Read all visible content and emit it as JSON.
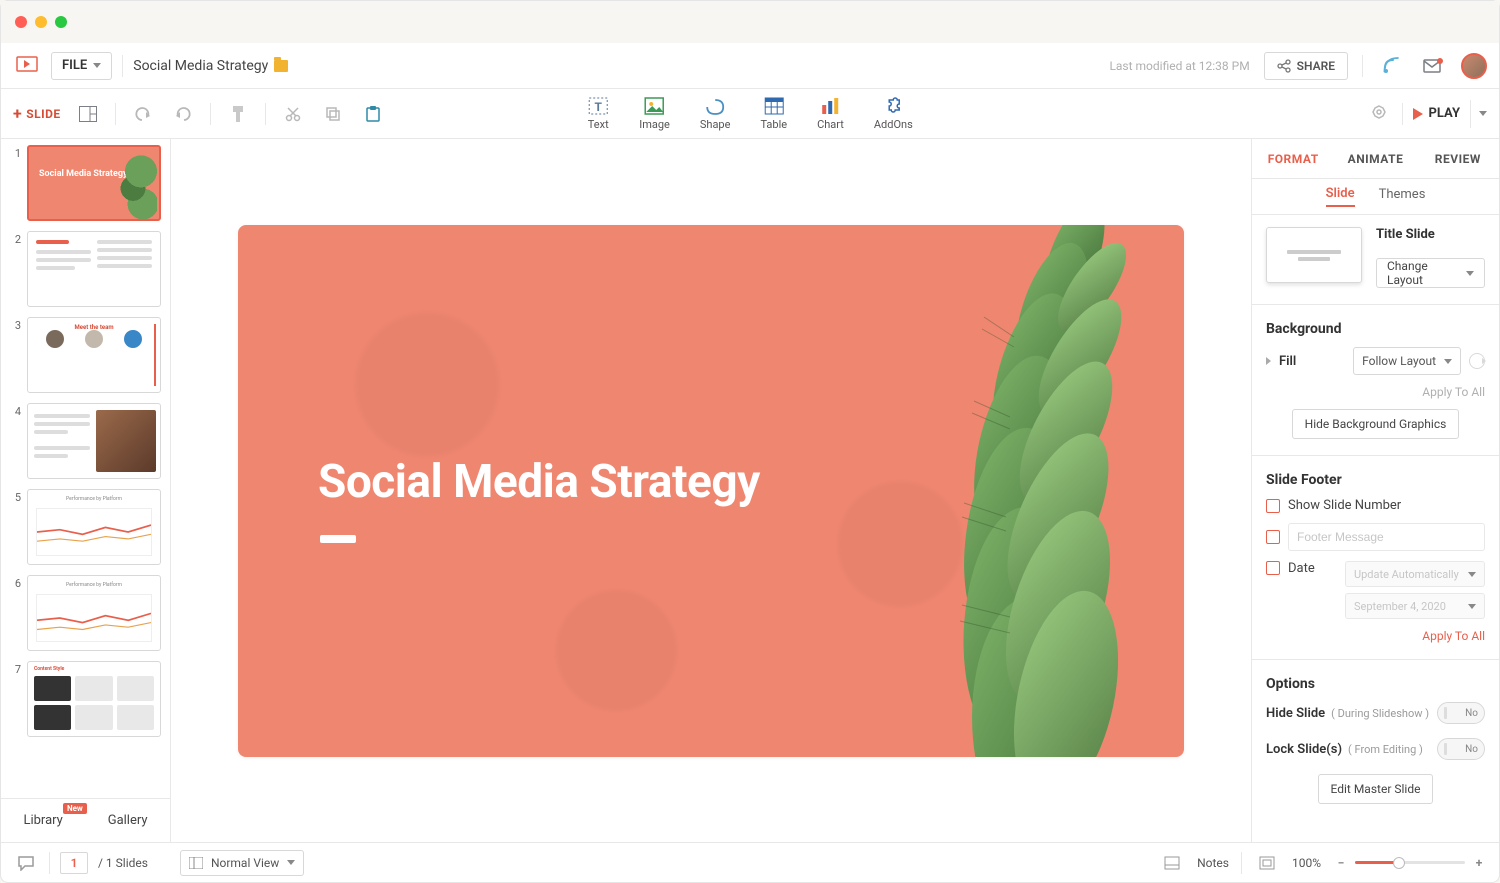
{
  "header": {
    "file_label": "FILE",
    "doc_title": "Social Media Strategy",
    "last_modified": "Last modified at 12:38 PM",
    "share_label": "SHARE"
  },
  "toolbar2": {
    "add_slide": "SLIDE",
    "insert": {
      "text": "Text",
      "image": "Image",
      "shape": "Shape",
      "table": "Table",
      "chart": "Chart",
      "addons": "AddOns"
    },
    "play_label": "PLAY"
  },
  "thumbs": {
    "title_slide_text": "Social Media Strategy",
    "rail_tabs": {
      "library": "Library",
      "library_badge": "New",
      "gallery": "Gallery"
    }
  },
  "canvas": {
    "slide_title": "Social Media Strategy"
  },
  "panel": {
    "tabs": {
      "format": "FORMAT",
      "animate": "ANIMATE",
      "review": "REVIEW"
    },
    "subtabs": {
      "slide": "Slide",
      "themes": "Themes"
    },
    "layout_name": "Title Slide",
    "change_layout": "Change Layout",
    "background": {
      "title": "Background",
      "fill_label": "Fill",
      "fill_value": "Follow Layout",
      "apply_all": "Apply To All",
      "hide_bg": "Hide Background Graphics"
    },
    "footer": {
      "title": "Slide Footer",
      "show_num": "Show Slide Number",
      "msg_placeholder": "Footer Message",
      "date_label": "Date",
      "update_auto": "Update Automatically",
      "date_value": "September 4, 2020",
      "apply_all": "Apply To All"
    },
    "options": {
      "title": "Options",
      "hide_slide": "Hide Slide",
      "hide_hint": "( During Slideshow )",
      "lock_slide": "Lock Slide(s)",
      "lock_hint": "( From Editing )",
      "no": "No"
    },
    "master": "Edit Master Slide"
  },
  "status": {
    "page_current": "1",
    "page_total": "/ 1 Slides",
    "view": "Normal View",
    "notes": "Notes",
    "zoom": "100%"
  }
}
